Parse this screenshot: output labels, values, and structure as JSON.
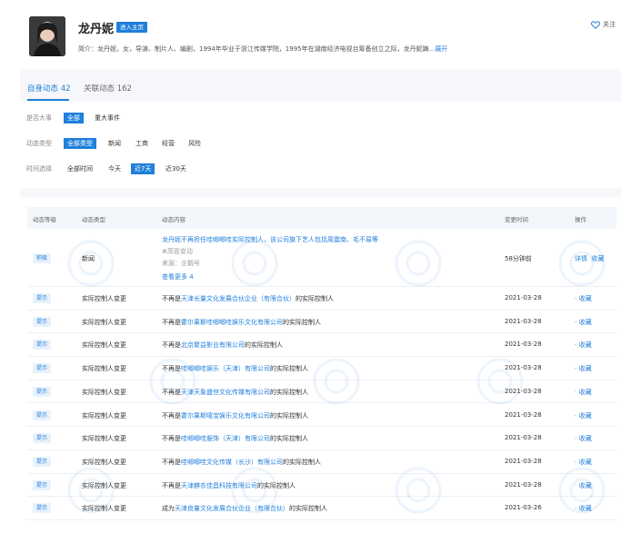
{
  "profile": {
    "name": "龙丹妮",
    "badge": "进入主页",
    "intro_prefix": "简介：",
    "intro": "龙丹妮，女，导演、制片人、编剧，1994年毕业于浙江传媒学院，1995年在湖南经济电视台筹备创立之际，龙丹妮踌...",
    "expand": "展开",
    "follow": "关注"
  },
  "tabs": [
    {
      "label": "自身动态 42"
    },
    {
      "label": "关联动态 162"
    }
  ],
  "filters": {
    "row1_label": "是否大事",
    "row1_options": [
      "全部",
      "重大事件"
    ],
    "row2_label": "动态类型",
    "row2_options": [
      "全部类型",
      "新闻",
      "工商",
      "经营",
      "风险"
    ],
    "row3_label": "时间选择",
    "row3_options": [
      "全部时间",
      "今天",
      "近7天",
      "近30天"
    ]
  },
  "table": {
    "headers": [
      "动态等级",
      "动态类型",
      "动态内容",
      "变更时间",
      "操作"
    ],
    "first_row": {
      "level": "积极",
      "type": "新闻",
      "title": "龙丹妮不再担任哇唧唧哇实际控制人，该公司旗下艺人包括周震南、毛不易等",
      "tag_line": "#高管变动",
      "source": "来源：企鹅号",
      "more": "查看更多 4",
      "time": "58分钟前",
      "op1": "详情",
      "op2": "收藏"
    },
    "rows": [
      {
        "level": "提示",
        "type": "实际控制人变更",
        "pre": "不再是",
        "company": "天津长量文化发展合伙企业（有限合伙）",
        "post": "的实际控制人",
        "time": "2021-03-28",
        "op": "收藏"
      },
      {
        "level": "提示",
        "type": "实际控制人变更",
        "pre": "不再是",
        "company": "霍尔果斯哇唧唧哇娱乐文化有限公司",
        "post": "的实际控制人",
        "time": "2021-03-28",
        "op": "收藏"
      },
      {
        "level": "提示",
        "type": "实际控制人变更",
        "pre": "不再是",
        "company": "北京聚益影业有限公司",
        "post": "的实际控制人",
        "time": "2021-03-28",
        "op": "收藏"
      },
      {
        "level": "提示",
        "type": "实际控制人变更",
        "pre": "不再是",
        "company": "哇唧唧哇娱乐（天津）有限公司",
        "post": "的实际控制人",
        "time": "2021-03-28",
        "op": "收藏"
      },
      {
        "level": "提示",
        "type": "实际控制人变更",
        "pre": "不再是",
        "company": "天津天象盛世文化传媒有限公司",
        "post": "的实际控制人",
        "time": "2021-03-28",
        "op": "收藏"
      },
      {
        "level": "提示",
        "type": "实际控制人变更",
        "pre": "不再是",
        "company": "霍尔果斯嘻宝娱乐文化有限公司",
        "post": "的实际控制人",
        "time": "2021-03-28",
        "op": "收藏"
      },
      {
        "level": "提示",
        "type": "实际控制人变更",
        "pre": "不再是",
        "company": "哇唧唧哇服饰（天津）有限公司",
        "post": "的实际控制人",
        "time": "2021-03-28",
        "op": "收藏"
      },
      {
        "level": "提示",
        "type": "实际控制人变更",
        "pre": "不再是",
        "company": "哇唧唧哇文化传媒（长沙）有限公司",
        "post": "的实际控制人",
        "time": "2021-03-28",
        "op": "收藏"
      },
      {
        "level": "提示",
        "type": "实际控制人变更",
        "pre": "不再是",
        "company": "天津麒衣佳昌科技有限公司",
        "post": "的实际控制人",
        "time": "2021-03-28",
        "op": "收藏"
      },
      {
        "level": "提示",
        "type": "实际控制人变更",
        "pre": "成为",
        "company": "天津良量文化发展合伙企业（有限合伙）",
        "post": "的实际控制人",
        "time": "2021-03-26",
        "op": "收藏"
      }
    ]
  },
  "colors": {
    "accent": "#1f7fdc",
    "band": "#f5f7fa"
  },
  "icons": {
    "follow": "heart-icon"
  }
}
